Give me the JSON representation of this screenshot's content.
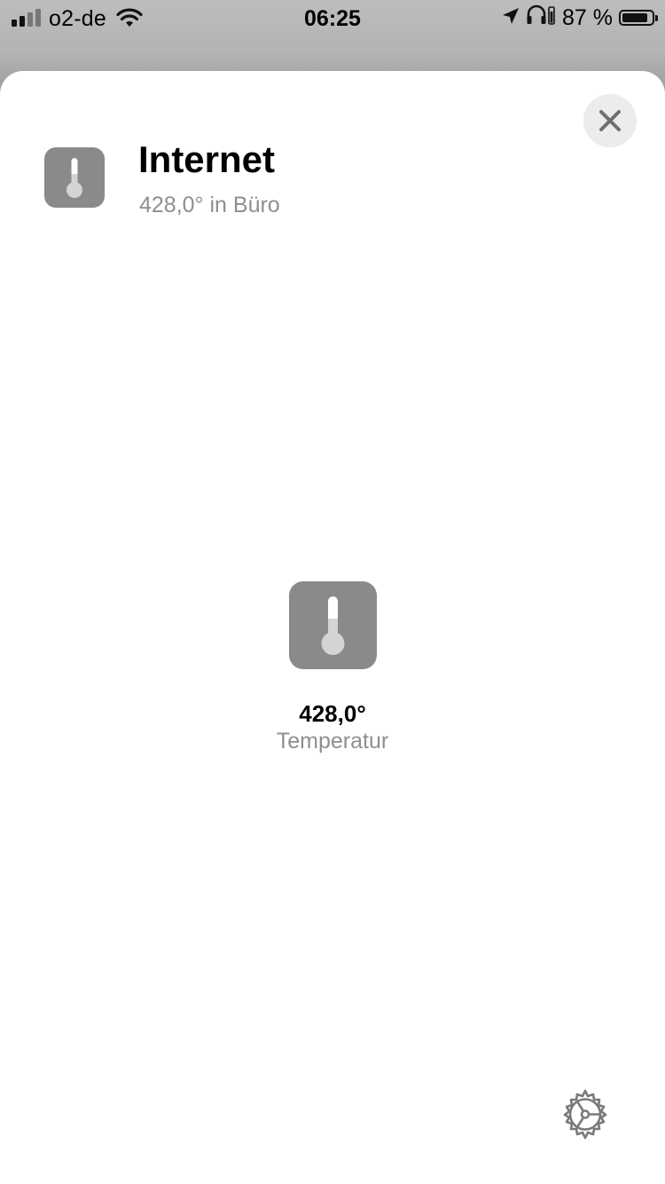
{
  "status_bar": {
    "carrier": "o2-de",
    "time": "06:25",
    "battery_percent": "87 %",
    "battery_level": 0.87,
    "signal_bars_active": 2,
    "signal_bars_total": 4,
    "icons": [
      "signal-icon",
      "wifi-icon",
      "location-arrow-icon",
      "headphones-icon",
      "battery-icon"
    ]
  },
  "header": {
    "title": "Internet",
    "subtitle": "428,0° in Büro",
    "icon": "thermometer-icon"
  },
  "tile": {
    "value": "428,0°",
    "label": "Temperatur",
    "icon": "thermometer-icon"
  },
  "controls": {
    "close_icon": "close-icon",
    "settings_icon": "gear-icon"
  },
  "colors": {
    "icon_background": "#8a8a8a",
    "secondary_text": "#8e8e93",
    "close_button_background": "#ececec",
    "sheet_background": "#ffffff"
  }
}
